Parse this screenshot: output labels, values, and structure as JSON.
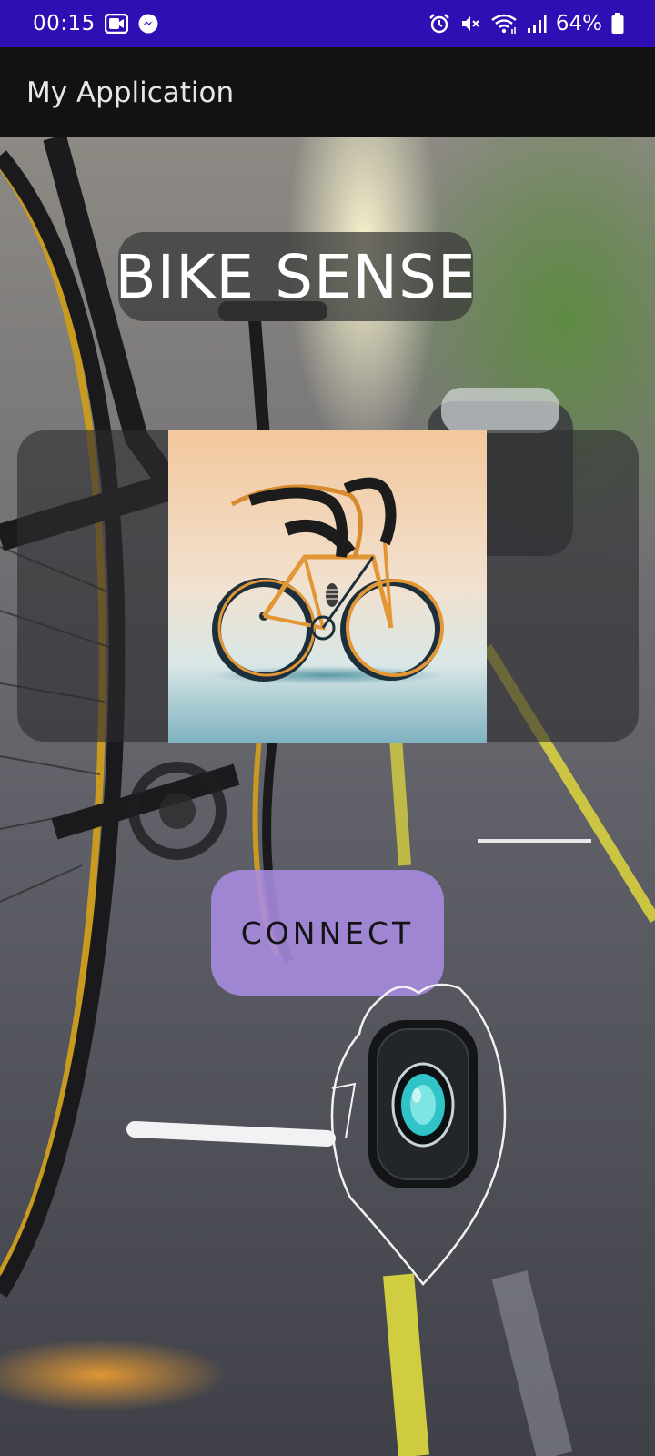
{
  "status_bar": {
    "time": "00:15",
    "battery_percent": "64%",
    "icons": [
      "video-app-icon",
      "messenger-icon",
      "alarm-icon",
      "mute-icon",
      "wifi-icon",
      "signal-icon",
      "battery-icon"
    ]
  },
  "app_bar": {
    "title": "My Application"
  },
  "main": {
    "app_name": "BIKE SENSE",
    "connect_label": "CONNECT"
  },
  "colors": {
    "status_bar": "#2f0fb3",
    "app_bar": "#121212",
    "connect_button": "#aa8ce1"
  }
}
